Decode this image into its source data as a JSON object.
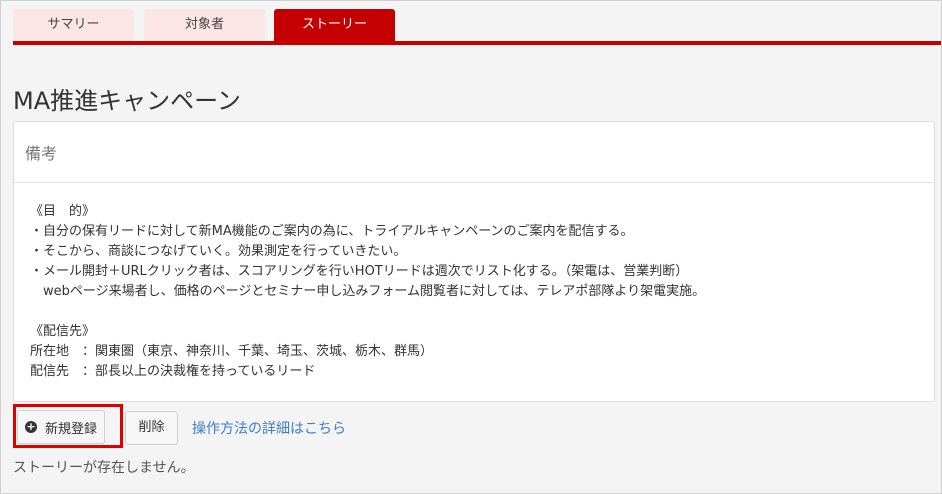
{
  "tabs": [
    {
      "label": "サマリー",
      "active": false
    },
    {
      "label": "対象者",
      "active": false
    },
    {
      "label": "ストーリー",
      "active": true
    }
  ],
  "page": {
    "title": "MA推進キャンペーン"
  },
  "panel": {
    "heading": "備考",
    "lines": [
      "《目　的》",
      "・自分の保有リードに対して新MA機能のご案内の為に、トライアルキャンペーンのご案内を配信する。",
      "・そこから、商談につなげていく。効果測定を行っていきたい。",
      "・メール開封＋URLクリック者は、スコアリングを行いHOTリードは週次でリスト化する。（架電は、営業判断）",
      "　webページ来場者し、価格のページとセミナー申し込みフォーム閲覧者に対しては、テレアポ部隊より架電実施。",
      "",
      "《配信先》",
      "所在地　：関東圏（東京、神奈川、千葉、埼玉、茨城、栃木、群馬）",
      "配信先　：部長以上の決裁権を持っているリード"
    ]
  },
  "actions": {
    "new_label": "新規登録",
    "delete_label": "削除",
    "help_link": "操作方法の詳細はこちら"
  },
  "status": {
    "empty_message": "ストーリーが存在しません。"
  },
  "colors": {
    "accent": "#c40000",
    "highlight": "#e00000",
    "link": "#3a7ecf"
  }
}
